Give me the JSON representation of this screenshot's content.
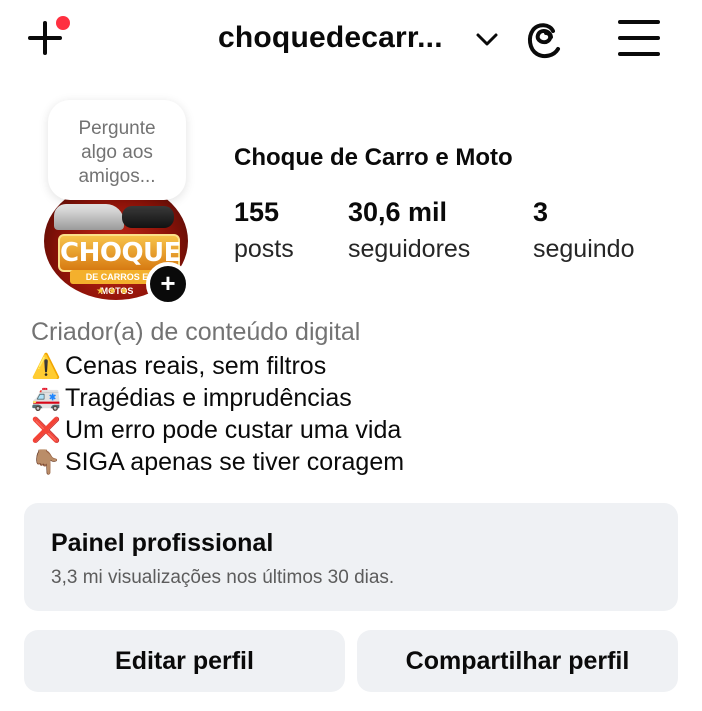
{
  "header": {
    "username": "choquedecarr...",
    "icons": {
      "create": "plus-icon",
      "notification_dot_color": "#ff3040",
      "dropdown": "chevron-down-icon",
      "threads": "threads-icon",
      "menu": "hamburger-menu-icon"
    }
  },
  "profile": {
    "note_lines": [
      "Pergunte",
      "algo aos",
      "amigos..."
    ],
    "avatar_text": "CHOQUE",
    "avatar_subtext": "DE CARROS E MOTOS",
    "display_name": "Choque de Carro e Moto",
    "stats": [
      {
        "value": "155",
        "label": "posts"
      },
      {
        "value": "30,6 mil",
        "label": "seguidores"
      },
      {
        "value": "3",
        "label": "seguindo"
      }
    ]
  },
  "bio": {
    "category": "Criador(a) de conteúdo digital",
    "lines": [
      {
        "emoji": "⚠️",
        "text": "Cenas reais, sem filtros"
      },
      {
        "emoji": "🚑",
        "text": "Tragédias e imprudências"
      },
      {
        "emoji": "❌",
        "text": "Um erro pode custar uma vida"
      },
      {
        "emoji": "👇🏽",
        "text": "SIGA apenas se tiver coragem"
      }
    ]
  },
  "dashboard": {
    "title": "Painel profissional",
    "subtitle": "3,3 mi visualizações nos últimos 30 dias."
  },
  "actions": {
    "edit_label": "Editar perfil",
    "share_label": "Compartilhar perfil"
  }
}
